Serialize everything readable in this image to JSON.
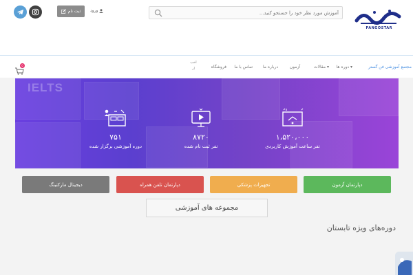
{
  "header": {
    "logo_text": "PANGOSTAR",
    "search": {
      "placeholder": "آموزش مورد نظر خود را جستجو کنید...",
      "icon": "search-icon"
    },
    "register_label": "ثبت نام",
    "login_label": "ورود",
    "social": [
      {
        "name": "telegram-icon",
        "color": "#5aa0d6"
      },
      {
        "name": "instagram-icon",
        "color": "#404040"
      }
    ]
  },
  "nav": {
    "items": [
      {
        "label": "مجتمع آموزشی فن گستر",
        "active": true
      },
      {
        "label": "دوره ها ▾"
      },
      {
        "label": "مقالات ▾"
      },
      {
        "label": "آزمون"
      },
      {
        "label": "درباره ما"
      },
      {
        "label": "تماس با ما"
      },
      {
        "label": "فروشگاه"
      }
    ],
    "latest_line1": "اخب",
    "latest_line2": "ار",
    "cart_count": "0"
  },
  "hero": {
    "bg_word": "IELTS",
    "stats": [
      {
        "value": "۱،۵۲۰،۰۰۰",
        "label": "نفر ساعت آموزش کاربردی",
        "icon": "certificate-icon"
      },
      {
        "value": "۸۷۲۰",
        "label": "نفر ثبت نام شده",
        "icon": "monitor-play-icon"
      },
      {
        "value": "۷۵۱",
        "label": "دوره آموزشی برگزار شده",
        "icon": "classroom-icon"
      }
    ]
  },
  "departments": [
    {
      "label": "دپارتمان آزمون",
      "color": "#5cb85c"
    },
    {
      "label": "تجهیزات پزشکی",
      "color": "#f0ad4e"
    },
    {
      "label": "دپارتمان تلفن همراه",
      "color": "#d9534f"
    },
    {
      "label": "دیجیتال مارکتینگ",
      "color": "#7a7a7a"
    }
  ],
  "collection_label": "مجموعه های آموزشی",
  "section_title": "دوره‌های ویژه تابستان"
}
